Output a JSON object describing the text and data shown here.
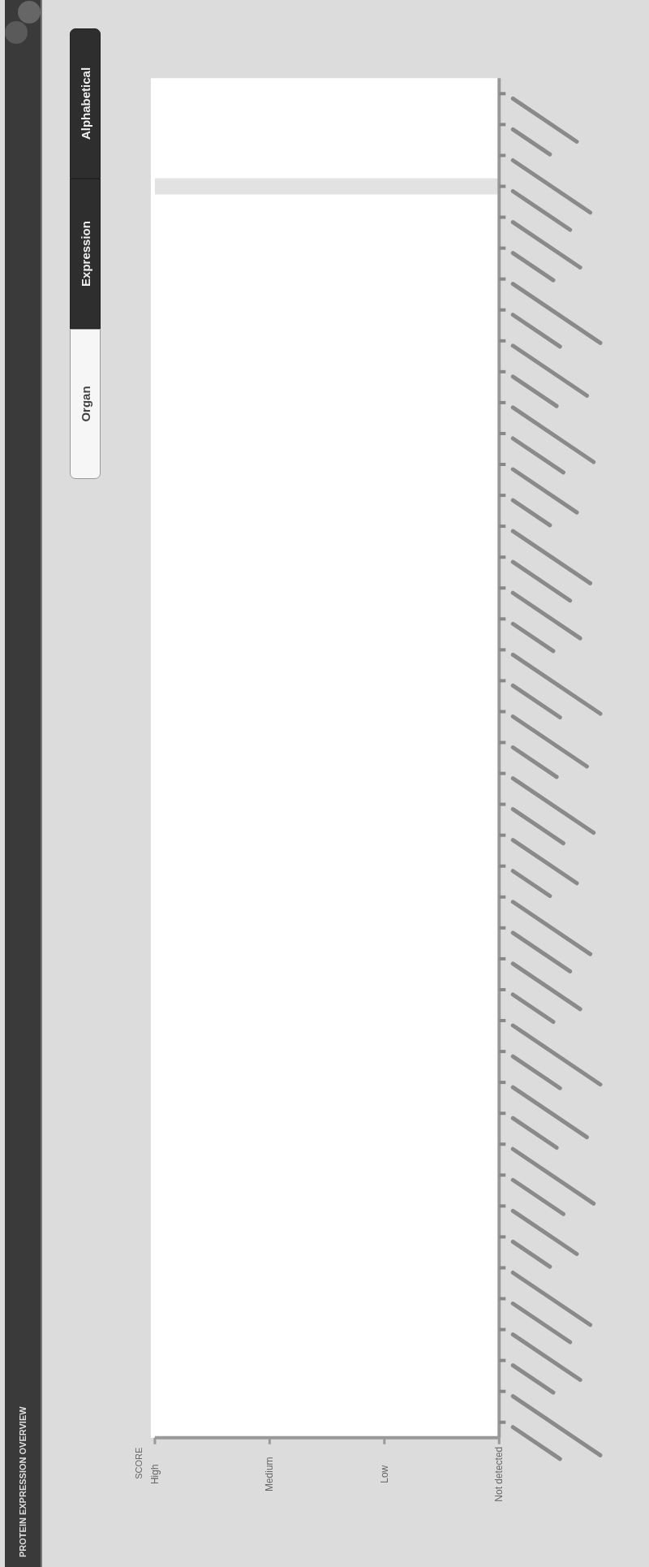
{
  "header": {
    "title": "PROTEIN EXPRESSION OVERVIEW"
  },
  "sort_buttons": [
    {
      "label": "Organ",
      "selected": false
    },
    {
      "label": "Expression",
      "selected": true
    },
    {
      "label": "Alphabetical",
      "selected": true
    }
  ],
  "score_axis": {
    "title": "SCORE",
    "levels": [
      "High",
      "Medium",
      "Low",
      "Not detected"
    ]
  }
}
